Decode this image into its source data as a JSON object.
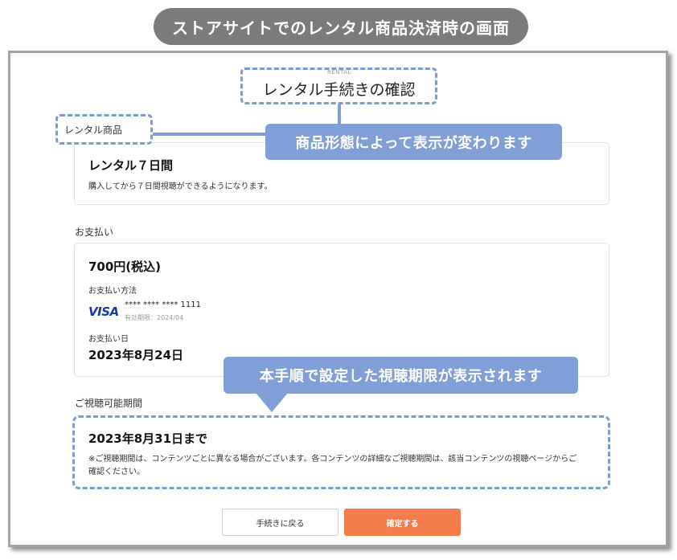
{
  "banner": {
    "text": "ストアサイトでのレンタル商品決済時の画面"
  },
  "header": {
    "eyebrow": "RENTAL",
    "title": "レンタル手続きの確認"
  },
  "rental": {
    "section_label": "レンタル商品",
    "name": "レンタル７日間",
    "description": "購入してから７日間視聴ができるようになります。"
  },
  "payment": {
    "section_label": "お支払い",
    "amount": "700円(税込)",
    "method_label": "お支払い方法",
    "card_brand": "VISA",
    "card_number": "**** **** **** 1111",
    "card_expiry": "有効期限：2024/04",
    "date_label": "お支払い日",
    "date": "2023年8月24日"
  },
  "viewing": {
    "section_label": "ご視聴可能期間",
    "until": "2023年8月31日まで",
    "note_line1": "※ご視聴期間は、コンテンツごとに異なる場合がございます。各コンテンツの詳細なご視聴期間は、該当コンテンツの視聴ページからご",
    "note_line2": "確認ください。"
  },
  "callouts": {
    "product_type": "商品形態によって表示が変わります",
    "viewing_period": "本手順で設定した視聴期限が表示されます"
  },
  "actions": {
    "back_label": "手続きに戻る",
    "confirm_label": "確定する"
  },
  "colors": {
    "accent": "#f47c4d",
    "callout": "#7f9fd6",
    "banner": "#7b7b7b",
    "visa": "#1a35a0"
  }
}
